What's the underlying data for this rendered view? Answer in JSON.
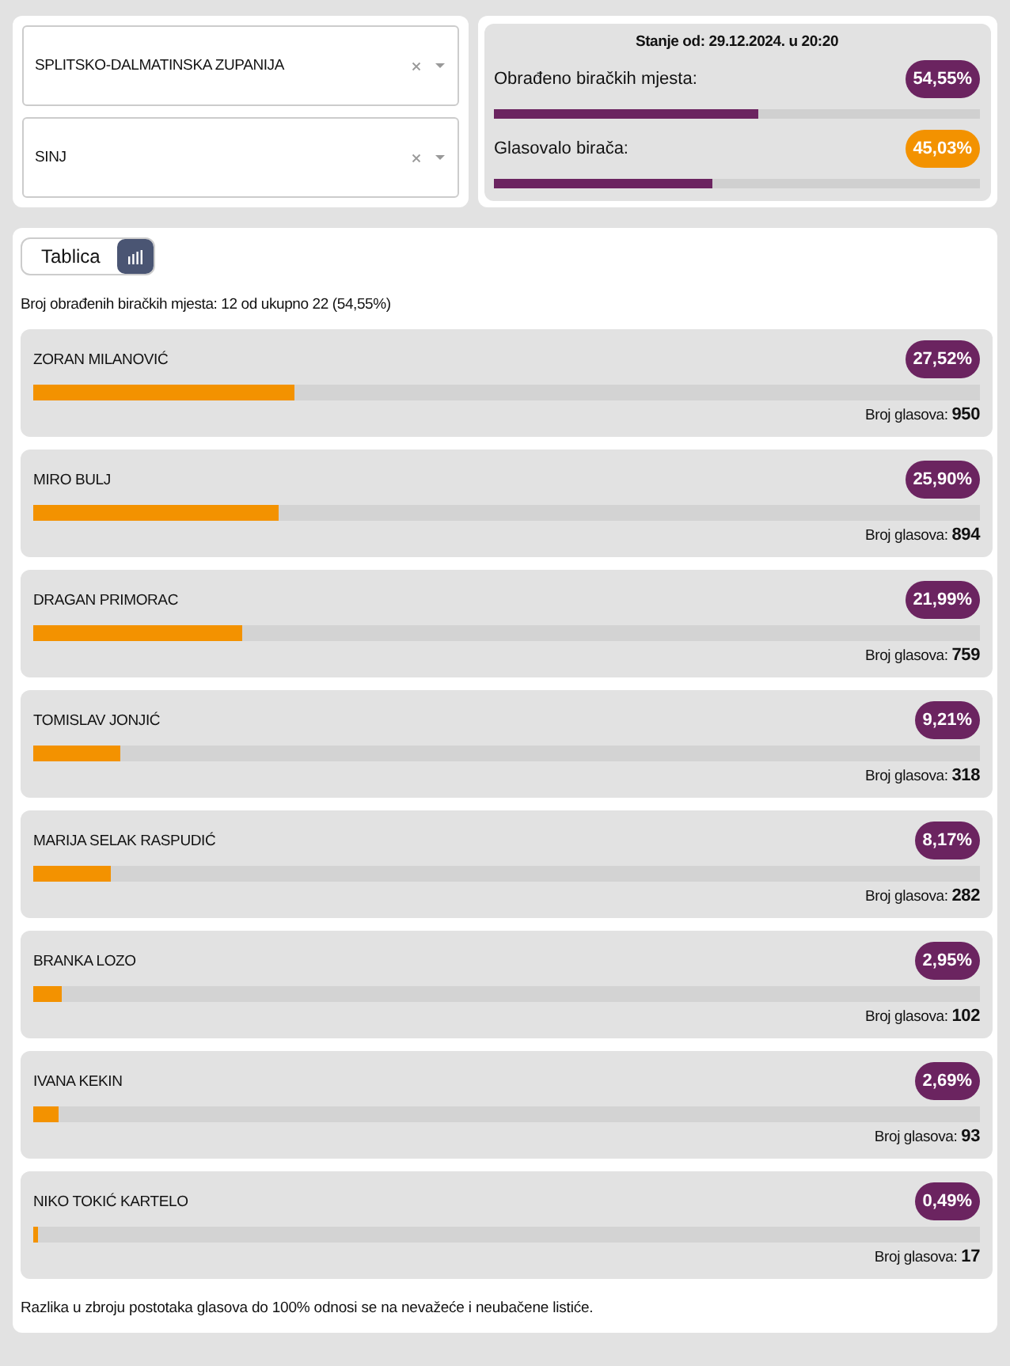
{
  "filters": [
    {
      "value": "SPLITSKO-DALMATINSKA ZUPANIJA"
    },
    {
      "value": "SINJ"
    }
  ],
  "status": {
    "title": "Stanje od: 29.12.2024. u 20:20",
    "stats": [
      {
        "label": "Obrađeno biračkih mjesta:",
        "value": "54,55%",
        "color": "#6b2460",
        "level": 0.5455
      },
      {
        "label": "Glasovalo birača:",
        "value": "45,03%",
        "color": "#f39200",
        "level": 0.4503
      }
    ]
  },
  "view_toggle": [
    {
      "kind": "text",
      "label": "Tablica",
      "selected": false
    },
    {
      "kind": "chart",
      "selected": true
    }
  ],
  "summary": "Broj obrađenih biračkih mjesta: 12 od ukupno 22 (54,55%)",
  "candidates": [
    {
      "name": "ZORAN MILANOVIĆ",
      "percent": "27,52%",
      "level": 0.2752,
      "votes": "Broj glasova: **950**"
    },
    {
      "name": "MIRO BULJ",
      "percent": "25,90%",
      "level": 0.259,
      "votes": "Broj glasova: **894**"
    },
    {
      "name": "DRAGAN PRIMORAC",
      "percent": "21,99%",
      "level": 0.2199,
      "votes": "Broj glasova: **759**"
    },
    {
      "name": "TOMISLAV JONJIĆ",
      "percent": "9,21%",
      "level": 0.0921,
      "votes": "Broj glasova: **318**"
    },
    {
      "name": "MARIJA SELAK RASPUDIĆ",
      "percent": "8,17%",
      "level": 0.0817,
      "votes": "Broj glasova: **282**"
    },
    {
      "name": "BRANKA LOZO",
      "percent": "2,95%",
      "level": 0.0295,
      "votes": "Broj glasova: **102**"
    },
    {
      "name": "IVANA KEKIN",
      "percent": "2,69%",
      "level": 0.0269,
      "votes": "Broj glasova: **93**"
    },
    {
      "name": "NIKO TOKIĆ KARTELO",
      "percent": "0,49%",
      "level": 0.0049,
      "votes": "Broj glasova: **17**"
    }
  ],
  "footnote": "Razlika u zbroju postotaka glasova do 100% odnosi se na nevažeće i neubačene listiće."
}
